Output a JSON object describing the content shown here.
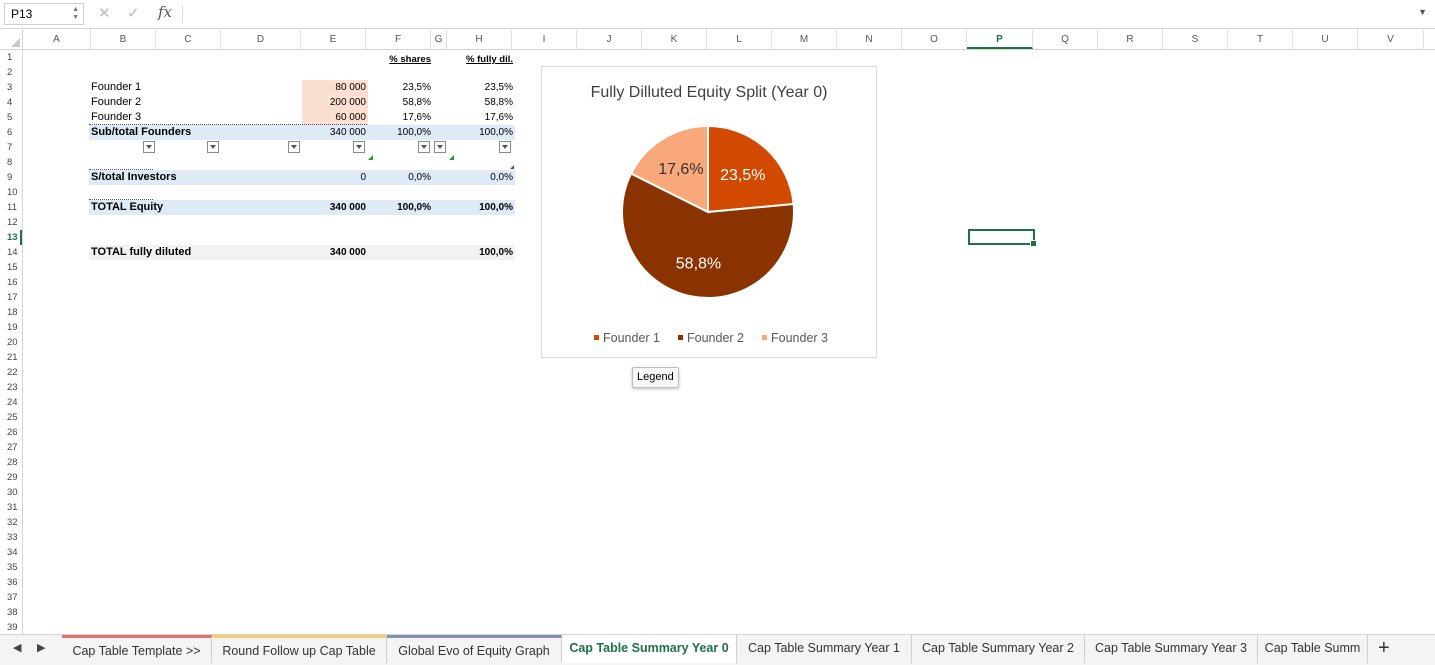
{
  "formula_bar": {
    "cell_ref": "P13",
    "cancel_icon": "✕",
    "confirm_icon": "✓",
    "fx_label": "fx",
    "value": ""
  },
  "columns": [
    "A",
    "B",
    "C",
    "D",
    "E",
    "F",
    "G",
    "H",
    "I",
    "J",
    "K",
    "L",
    "M",
    "N",
    "O",
    "P",
    "Q",
    "R",
    "S",
    "T",
    "U",
    "V"
  ],
  "selected_column": "P",
  "rows": [
    "1",
    "2",
    "3",
    "4",
    "5",
    "6",
    "7",
    "8",
    "9",
    "10",
    "11",
    "12",
    "13",
    "14",
    "15",
    "16",
    "17",
    "18",
    "19",
    "20",
    "21",
    "22",
    "23",
    "24",
    "25",
    "26",
    "27",
    "28",
    "29",
    "30",
    "31",
    "32",
    "33",
    "34",
    "35",
    "36",
    "37",
    "38",
    "39"
  ],
  "selected_row": "13",
  "sheet": {
    "hdr_shares": "% shares",
    "hdr_fully": "% fully dil.",
    "founders": [
      {
        "name": "Founder 1",
        "shares": "80 000",
        "pct": "23,5%",
        "fully": "23,5%"
      },
      {
        "name": "Founder 2",
        "shares": "200 000",
        "pct": "58,8%",
        "fully": "58,8%"
      },
      {
        "name": "Founder 3",
        "shares": "60 000",
        "pct": "17,6%",
        "fully": "17,6%"
      }
    ],
    "subtotal": {
      "label": "Sub/total Founders",
      "shares": "340 000",
      "pct": "100,0%",
      "fully": "100,0%"
    },
    "investors": {
      "label": "S/total Investors",
      "shares": "0",
      "pct": "0,0%",
      "fully": "0,0%"
    },
    "equity": {
      "label": "TOTAL Equity",
      "shares": "340 000",
      "pct": "100,0%",
      "fully": "100,0%"
    },
    "diluted": {
      "label": "TOTAL fully diluted",
      "shares": "340 000",
      "fully": "100,0%"
    }
  },
  "chart_data": {
    "type": "pie",
    "title": "Fully Dilluted Equity Split (Year 0)",
    "categories": [
      "Founder 1",
      "Founder 2",
      "Founder 3"
    ],
    "values": [
      23.5,
      58.8,
      17.6
    ],
    "labels": [
      "23,5%",
      "58,8%",
      "17,6%"
    ],
    "colors": [
      "#d14a00",
      "#8b3300",
      "#f8a87a"
    ],
    "legend_position": "bottom"
  },
  "tooltip": "Legend",
  "tabs": [
    {
      "label": "Cap Table Template >>",
      "color": "#e07070"
    },
    {
      "label": "Round Follow up Cap Table",
      "color": "#f0d070"
    },
    {
      "label": "Global Evo of Equity Graph",
      "color": "#8090b0"
    },
    {
      "label": "Cap Table Summary Year 0",
      "color": ""
    },
    {
      "label": "Cap Table Summary Year 1",
      "color": ""
    },
    {
      "label": "Cap Table Summary Year 2",
      "color": ""
    },
    {
      "label": "Cap Table Summary Year 3",
      "color": ""
    },
    {
      "label": "Cap Table Summ",
      "color": ""
    }
  ],
  "active_tab": 3,
  "add_sheet": "+"
}
